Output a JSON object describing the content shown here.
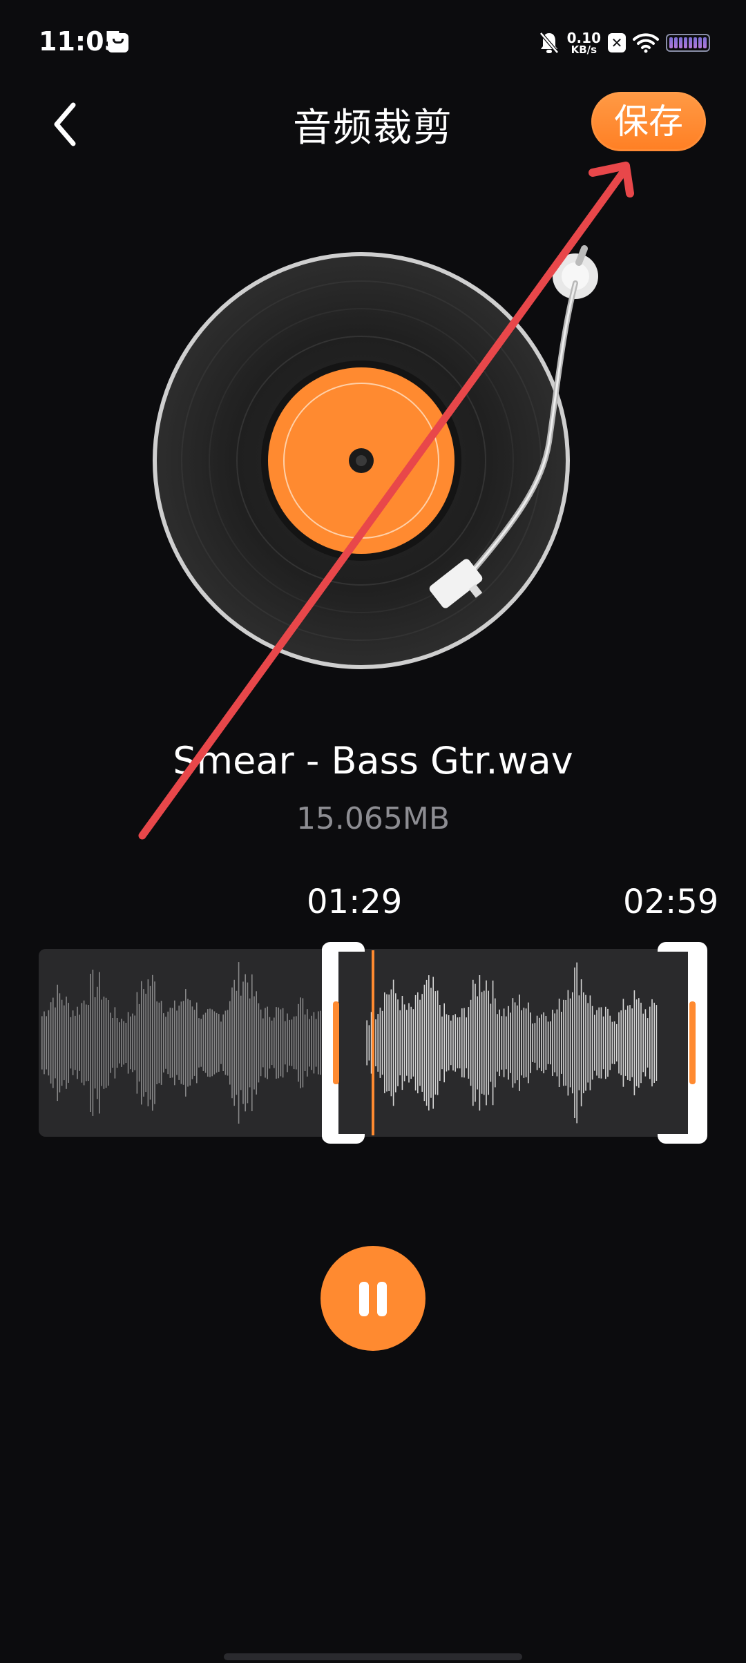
{
  "status_bar": {
    "time": "11:05",
    "net_speed_value": "0.10",
    "net_speed_unit": "KB/s",
    "icons": [
      "message-icon",
      "mute-bell-icon",
      "close-box-icon",
      "wifi-icon",
      "battery-icon"
    ]
  },
  "header": {
    "back_icon": "chevron-left-icon",
    "title": "音频裁剪",
    "save_label": "保存"
  },
  "track": {
    "file_name": "Smear - Bass Gtr.wav",
    "file_size": "15.065MB"
  },
  "trim": {
    "start_time": "01:29",
    "end_time": "02:59"
  },
  "player": {
    "state": "playing",
    "control_icon": "pause-icon"
  },
  "colors": {
    "accent": "#ff8a30",
    "background": "#0c0c0e",
    "annotation_arrow": "#e8474a"
  }
}
